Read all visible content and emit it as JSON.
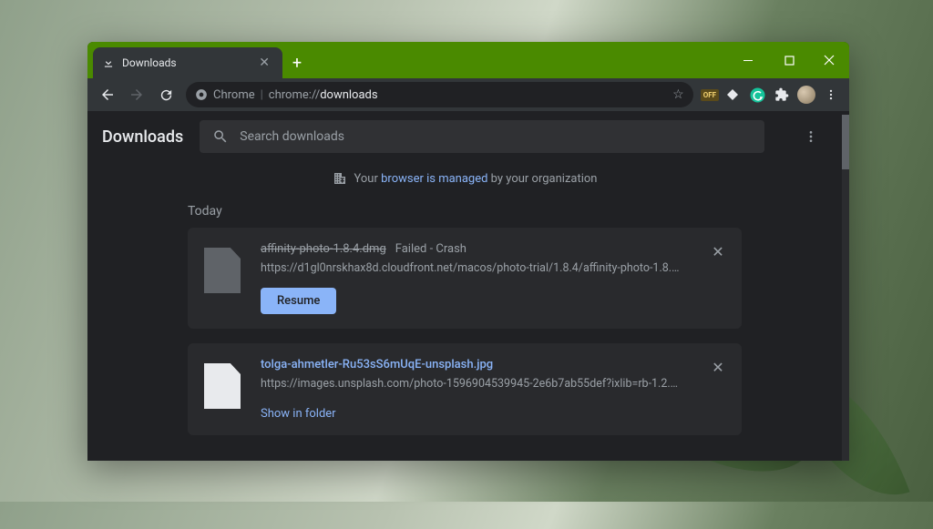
{
  "tab": {
    "title": "Downloads"
  },
  "omnibox": {
    "chip_label": "Chrome",
    "url_prefix": "chrome://",
    "url_path": "downloads"
  },
  "toolbar": {
    "title": "Downloads",
    "search_placeholder": "Search downloads"
  },
  "managed": {
    "prefix": "Your ",
    "link": "browser is managed",
    "suffix": " by your organization"
  },
  "date_header": "Today",
  "downloads": [
    {
      "filename": "affinity-photo-1.8.4.dmg",
      "status": "Failed - Crash",
      "source": "https://d1gl0nrskhax8d.cloudfront.net/macos/photo-trial/1.8.4/affinity-photo-1.8.4.d…",
      "action": "Resume",
      "failed": true
    },
    {
      "filename": "tolga-ahmetler-Ru53sS6mUqE-unsplash.jpg",
      "status": "",
      "source": "https://images.unsplash.com/photo-1596904539945-2e6b7ab55def?ixlib=rb-1.2.1&q…",
      "action": "Show in folder",
      "failed": false
    }
  ],
  "buttons": {
    "resume": "Resume",
    "show_in_folder": "Show in folder"
  },
  "colors": {
    "accent": "#8ab4f8",
    "bg": "#202124",
    "card": "#292a2d"
  }
}
